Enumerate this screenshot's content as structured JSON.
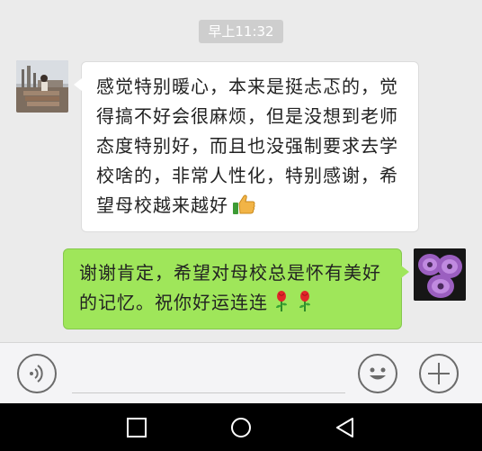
{
  "chat": {
    "timestamp": "早上11:32",
    "messages": [
      {
        "side": "left",
        "text": "感觉特别暖心，本来是挺忐忑的，觉得搞不好会很麻烦，但是没想到老师态度特别好，而且也没强制要求去学校啥的，非常人性化，特别感谢，希望母校越来越好",
        "trailing_emoji": "thumbs-up-icon"
      },
      {
        "side": "right",
        "text": "谢谢肯定，希望对母校总是怀有美好的记忆。祝你好运连连",
        "trailing_emoji": "rose-icon"
      }
    ]
  },
  "input_bar": {
    "voice_icon": "voice-icon",
    "emoji_icon": "emoji-icon",
    "plus_icon": "plus-icon"
  },
  "nav_bar": {
    "recent_icon": "recent-apps-icon",
    "home_icon": "home-icon",
    "back_icon": "back-icon"
  },
  "colors": {
    "chat_background": "#ebebeb",
    "received_bubble": "#ffffff",
    "sent_bubble": "#9fe65a",
    "timestamp_background": "#cecece",
    "nav_background": "#000000"
  }
}
